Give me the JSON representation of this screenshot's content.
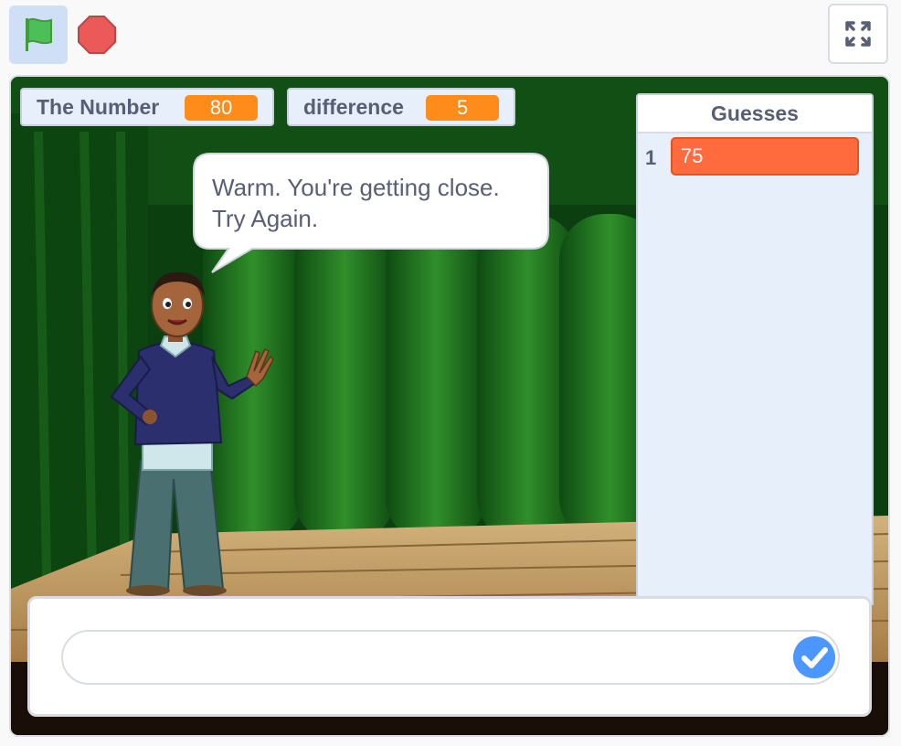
{
  "toolbar": {
    "green_flag_icon": "green-flag-icon",
    "stop_icon": "stop-sign-icon",
    "fullscreen_icon": "fullscreen-icon"
  },
  "monitors": [
    {
      "label": "The Number",
      "value": "80"
    },
    {
      "label": "difference",
      "value": "5"
    }
  ],
  "speech": {
    "line1": "Warm. You're getting close.",
    "line2": "Try Again."
  },
  "list": {
    "title": "Guesses",
    "items": [
      {
        "index": "1",
        "value": "75"
      }
    ]
  },
  "ask": {
    "value": "",
    "submit_icon": "checkmark-icon"
  },
  "colors": {
    "monitor_value": "#ff8c1a",
    "list_item": "#ff6b3d",
    "accent_blue": "#4c97ff",
    "stop_red": "#ec5959",
    "flag_green": "#4cbf56"
  }
}
